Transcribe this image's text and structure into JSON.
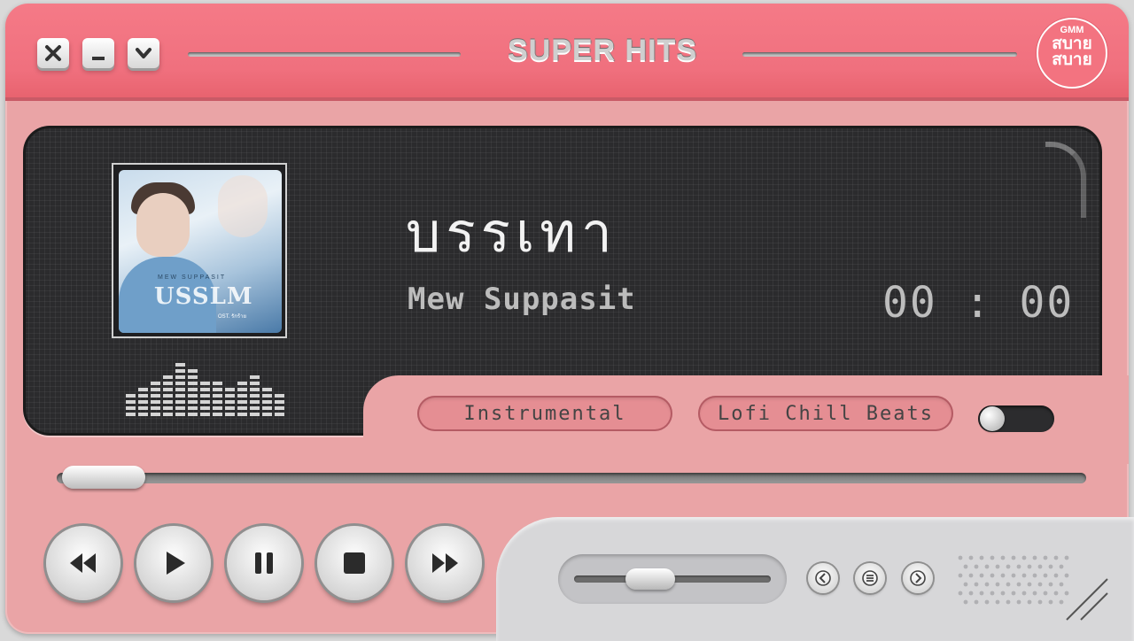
{
  "window": {
    "title": "SUPER HITS",
    "controls": [
      "close",
      "minimize",
      "dropdown"
    ]
  },
  "logo": {
    "top": "GMM",
    "brand_line1": "สบาย",
    "brand_line2": "สบาย"
  },
  "now_playing": {
    "title": "บรรเทา",
    "artist": "Mew Suppasit",
    "time": "00 : 00",
    "progress": 0.0
  },
  "cover": {
    "artist_text": "MEW SUPPASIT",
    "title_text": "USSLM",
    "ost_text": "OST. รักร้าย"
  },
  "tags": {
    "tag1": "Instrumental",
    "tag2": "Lofi Chill Beats"
  },
  "toggle": {
    "on": false
  },
  "volume": {
    "level": 0.4
  },
  "transport": [
    "rewind",
    "play",
    "pause",
    "stop",
    "fast-forward"
  ],
  "small_controls": [
    "previous",
    "menu",
    "next"
  ],
  "colors": {
    "titlebar": "#f0707e",
    "body": "#eaa4a6",
    "screen": "#2b2b2d",
    "deck": "#d7d7d9",
    "pill": "#e58e93"
  }
}
